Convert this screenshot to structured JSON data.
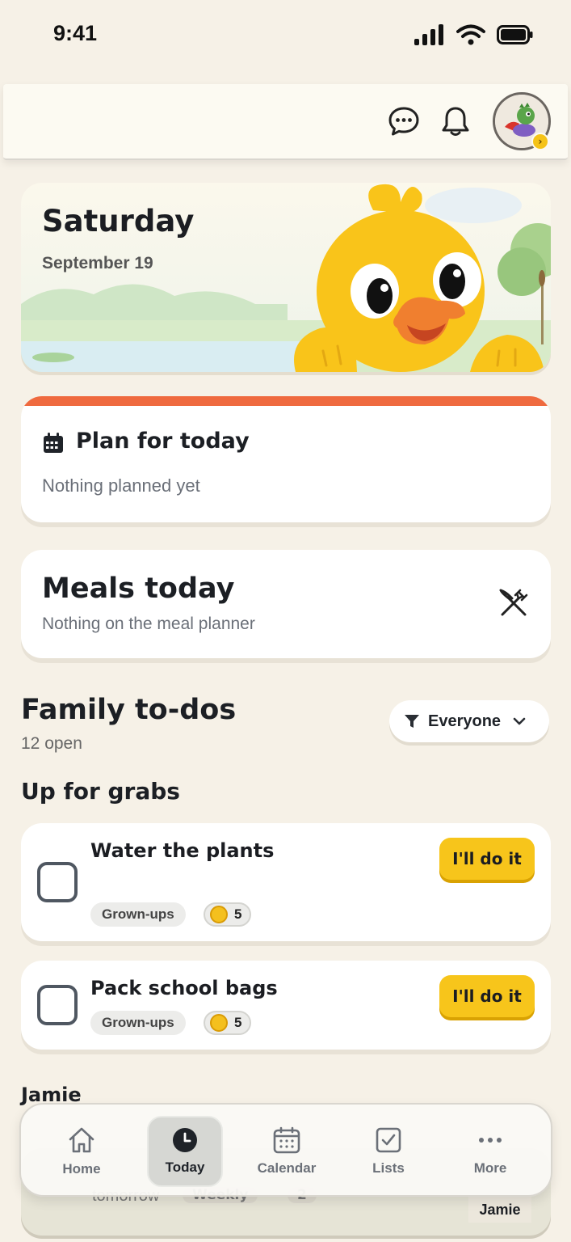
{
  "status": {
    "time": "9:41"
  },
  "hero": {
    "day": "Saturday",
    "date": "September 19"
  },
  "plan": {
    "title": "Plan for today",
    "subtitle": "Nothing planned yet"
  },
  "meals": {
    "title": "Meals today",
    "subtitle": "Nothing on the meal planner"
  },
  "todos": {
    "title": "Family to-dos",
    "count_label": "12 open",
    "filter_label": "Everyone",
    "section_label": "Up for grabs",
    "items": [
      {
        "title": "Water the plants",
        "tag": "Grown-ups",
        "coins": "5",
        "action": "I'll do it"
      },
      {
        "title": "Pack school bags",
        "tag": "Grown-ups",
        "coins": "5",
        "action": "I'll do it"
      }
    ],
    "person_section": "Jamie",
    "peek": {
      "text": "tomorrow",
      "tag": "Weekly",
      "coins": "2",
      "person": "Jamie"
    }
  },
  "tabs": [
    {
      "label": "Home",
      "icon": "home-icon"
    },
    {
      "label": "Today",
      "icon": "clock-icon"
    },
    {
      "label": "Calendar",
      "icon": "calendar-icon"
    },
    {
      "label": "Lists",
      "icon": "checkbox-icon"
    },
    {
      "label": "More",
      "icon": "more-icon"
    }
  ],
  "active_tab": "Today",
  "colors": {
    "accent": "#f7c51b",
    "plan_strip": "#ef6a3f",
    "background": "#f6f1e7"
  }
}
